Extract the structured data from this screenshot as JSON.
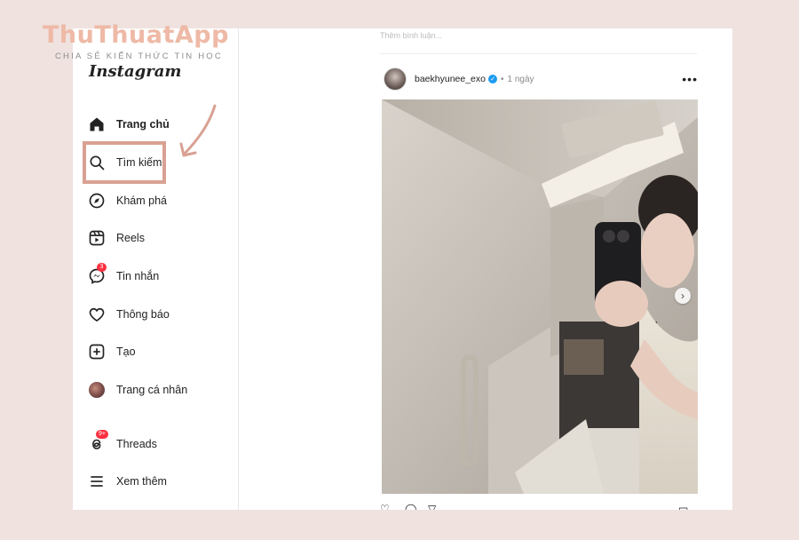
{
  "watermark": {
    "title": "ThuThuatApp",
    "subtitle": "CHIA SẺ KIẾN THỨC TIN HỌC"
  },
  "sidebar": {
    "logo": "Instagram",
    "items": [
      {
        "label": "Trang chủ",
        "icon": "home-icon",
        "active": true
      },
      {
        "label": "Tìm kiếm",
        "icon": "search-icon",
        "highlighted": true
      },
      {
        "label": "Khám phá",
        "icon": "compass-icon"
      },
      {
        "label": "Reels",
        "icon": "reels-icon"
      },
      {
        "label": "Tin nhắn",
        "icon": "messenger-icon",
        "badge": "3"
      },
      {
        "label": "Thông báo",
        "icon": "heart-icon"
      },
      {
        "label": "Tạo",
        "icon": "create-icon"
      },
      {
        "label": "Trang cá nhân",
        "icon": "profile-avatar"
      },
      {
        "label": "Threads",
        "icon": "threads-icon",
        "badge": "9+"
      },
      {
        "label": "Xem thêm",
        "icon": "menu-icon"
      }
    ]
  },
  "post": {
    "top_faded_text": "Thêm bình luận...",
    "username": "baekhyunee_exo",
    "verified": true,
    "separator": "•",
    "time": "1 ngày",
    "more": "•••"
  },
  "colors": {
    "page_bg": "#efe2df",
    "highlight": "#d9a193",
    "badge": "#ff3040",
    "verified": "#1d9bf0"
  }
}
